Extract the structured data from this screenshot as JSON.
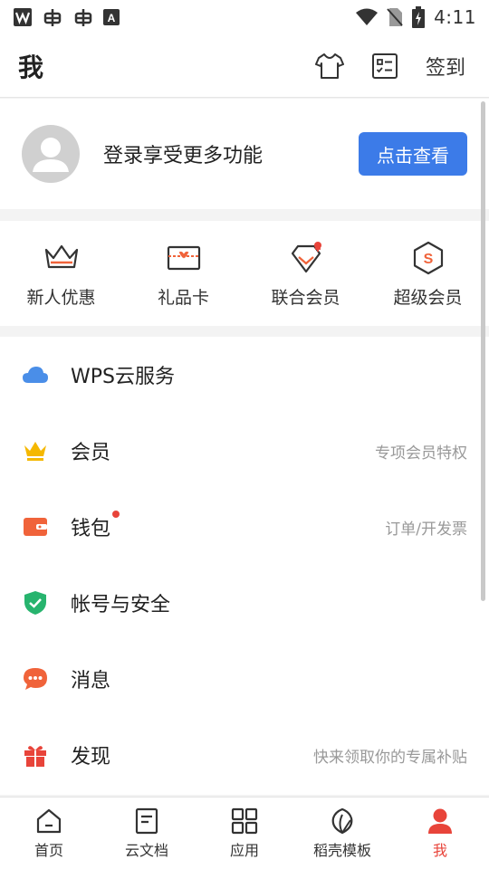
{
  "status_bar": {
    "time": "4:11",
    "left_icons": [
      "wps-logo-icon",
      "bug-icon",
      "bug-icon",
      "a-badge-icon"
    ],
    "right_icons": [
      "wifi-icon",
      "no-sim-icon",
      "battery-charging-icon"
    ]
  },
  "header": {
    "title": "我",
    "signin_label": "签到",
    "icons": [
      "shirt-icon",
      "checklist-icon"
    ]
  },
  "profile": {
    "login_text": "登录享受更多功能",
    "view_button": "点击查看"
  },
  "quick_links": [
    {
      "label": "新人优惠",
      "icon": "crown-outline-icon"
    },
    {
      "label": "礼品卡",
      "icon": "gift-card-icon"
    },
    {
      "label": "联合会员",
      "icon": "diamond-plus-icon"
    },
    {
      "label": "超级会员",
      "icon": "super-member-icon"
    }
  ],
  "menu": [
    {
      "label": "WPS云服务",
      "hint": "",
      "icon": "cloud-icon",
      "dot": false
    },
    {
      "label": "会员",
      "hint": "专项会员特权",
      "icon": "crown-icon",
      "dot": false
    },
    {
      "label": "钱包",
      "hint": "订单/开发票",
      "icon": "wallet-icon",
      "dot": true
    },
    {
      "label": "帐号与安全",
      "hint": "",
      "icon": "shield-icon",
      "dot": false
    },
    {
      "label": "消息",
      "hint": "",
      "icon": "message-icon",
      "dot": false
    },
    {
      "label": "发现",
      "hint": "快来领取你的专属补贴",
      "icon": "gift-icon",
      "dot": false
    }
  ],
  "bottom_nav": [
    {
      "label": "首页",
      "icon": "home-icon",
      "active": false
    },
    {
      "label": "云文档",
      "icon": "document-icon",
      "active": false
    },
    {
      "label": "应用",
      "icon": "apps-grid-icon",
      "active": false
    },
    {
      "label": "稻壳模板",
      "icon": "leaf-icon",
      "active": false
    },
    {
      "label": "我",
      "icon": "person-icon",
      "active": true
    }
  ],
  "colors": {
    "accent_blue": "#3c7be8",
    "accent_red": "#e8443a",
    "orange": "#f0633a",
    "gold": "#f5b800",
    "green": "#27b46e",
    "cloud_blue": "#4a8ee8"
  }
}
